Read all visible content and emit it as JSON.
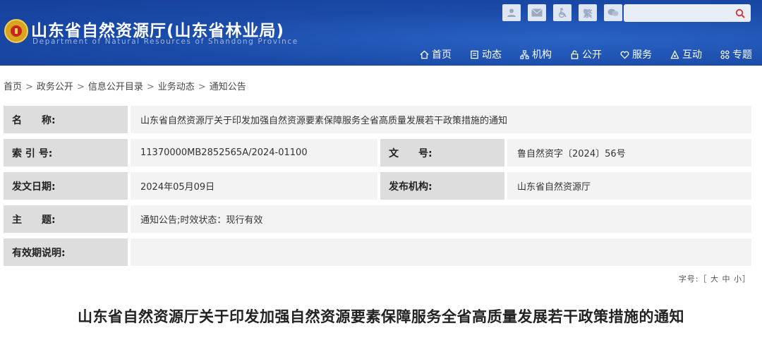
{
  "header": {
    "title": "山东省自然资源厅(山东省林业局)",
    "subtitle": "Department of Natural Resources of Shandong Province",
    "icons": [
      "user-icon",
      "mail-icon",
      "accessibility-icon",
      "traditional-chinese-icon",
      "chat-icon"
    ],
    "traditional_label": "繁"
  },
  "nav": {
    "items": [
      {
        "label": "首页",
        "icon": "home-icon"
      },
      {
        "label": "动态",
        "icon": "news-icon"
      },
      {
        "label": "机构",
        "icon": "org-icon"
      },
      {
        "label": "公开",
        "icon": "lock-icon"
      },
      {
        "label": "服务",
        "icon": "heart-icon"
      },
      {
        "label": "互动",
        "icon": "interact-icon"
      },
      {
        "label": "专题",
        "icon": "topics-icon"
      }
    ]
  },
  "breadcrumb": [
    "首页",
    "政务公开",
    "信息公开目录",
    "业务动态",
    "通知公告"
  ],
  "meta": {
    "name_label": "名　　称:",
    "name_value": "山东省自然资源厅关于印发加强自然资源要素保障服务全省高质量发展若干政策措施的通知",
    "index_label": "索 引 号:",
    "index_value": "11370000MB2852565A/2024-01100",
    "docno_label": "文　　号:",
    "docno_value": "鲁自然资字〔2024〕56号",
    "date_label": "发文日期:",
    "date_value": "2024年05月09日",
    "org_label": "发布机构:",
    "org_value": "山东省自然资源厅",
    "topic_label": "主　　题:",
    "topic_value": "通知公告;时效状态：现行有效",
    "validity_label": "有效期说明:",
    "validity_value": ""
  },
  "font_size": {
    "label": "字号:［",
    "large": "大",
    "medium": "中",
    "small": "小",
    "close": "］"
  },
  "document": {
    "title": "山东省自然资源厅关于印发加强自然资源要素保障服务全省高质量发展若干政策措施的通知"
  },
  "colors": {
    "header_bg": "#1a4aa8",
    "label_bg": "#dddddd",
    "value_bg": "#f3f3f3"
  }
}
